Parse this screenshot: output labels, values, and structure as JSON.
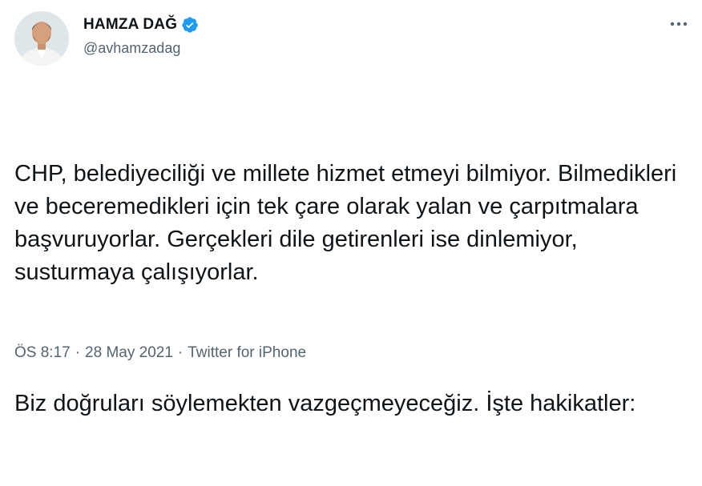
{
  "author": {
    "display_name": "HAMZA DAĞ",
    "handle": "@avhamzadag",
    "verified": true,
    "avatar_icon": "profile-photo",
    "verified_icon": "verified-badge-icon"
  },
  "tweet": {
    "paragraphs": [
      "CHP, belediyeciliği ve millete hizmet etmeyi bilmiyor. Bilmedikleri ve beceremedikleri için tek çare olarak yalan ve çarpıtmalara başvuruyorlar. Gerçekleri dile getirenleri ise dinlemiyor, susturmaya çalışıyorlar.",
      "Biz doğruları söylemekten vazgeçmeyeceğiz. İşte hakikatler:"
    ]
  },
  "meta": {
    "time": "ÖS 8:17",
    "date": "28 May 2021",
    "source": "Twitter for iPhone",
    "separator": "·"
  },
  "colors": {
    "text": "#0f1419",
    "secondary": "#536471",
    "verified": "#1d9bf0"
  },
  "icons": {
    "more": "more-options-icon"
  }
}
